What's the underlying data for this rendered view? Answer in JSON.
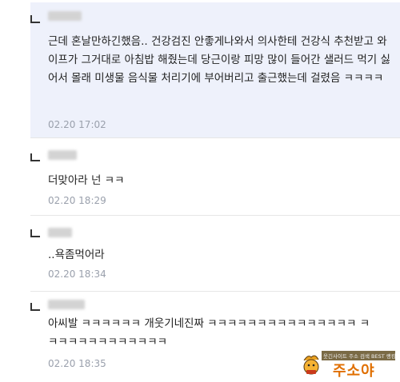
{
  "comments": [
    {
      "text": "근데 혼날만하긴했음.. 건강검진 안좋게나와서 의사한테 건강식 추천받고 와이프가 그거대로 아침밥 해줬는데 당근이랑 피망 많이 들어간 샐러드 먹기 싫어서 몰래 미생물 음식물 처리기에 부어버리고 출근했는데 걸렸음 ㅋㅋㅋㅋ",
      "time": "02.20 17:02"
    },
    {
      "text": "더맞아라 넌 ㅋㅋ",
      "time": "02.20 18:29"
    },
    {
      "text": "..욕좀먹어라",
      "time": "02.20 18:34"
    },
    {
      "text": "아씨발 ㅋㅋㅋㅋㅋㅋ 개웃기네진짜 ㅋㅋㅋㅋㅋㅋㅋㅋㅋㅋㅋㅋㅋㅋㅋ ㅋㅋㅋㅋㅋㅋㅋㅋㅋㅋㅋㅋㅋ",
      "time": "02.20 18:35"
    }
  ],
  "watermark": {
    "caption": "웃긴사이트 주소 검색 BEST 랭킹",
    "brand": "주소야"
  }
}
